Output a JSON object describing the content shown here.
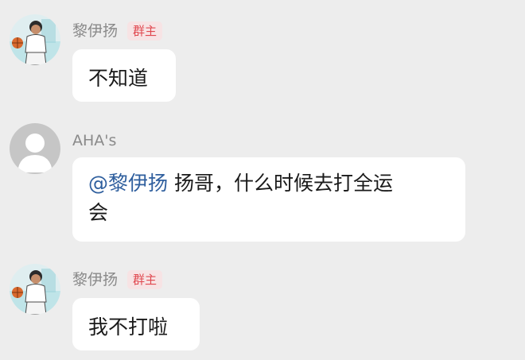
{
  "messages": [
    {
      "sender": "黎伊扬",
      "badge": "群主",
      "avatar_icon": "basketball-player-avatar-icon",
      "text": "不知道"
    },
    {
      "sender": "AHA's",
      "avatar_icon": "default-user-avatar-icon",
      "mention": "@黎伊扬",
      "text_line1": " 扬哥，什么时候去打全运",
      "text_line2": "会"
    },
    {
      "sender": "黎伊扬",
      "badge": "群主",
      "avatar_icon": "basketball-player-avatar-icon",
      "text": "我不打啦"
    }
  ],
  "colors": {
    "background": "#ededed",
    "bubble": "#ffffff",
    "mention": "#2f5f9e",
    "badge_text": "#e0484f",
    "badge_bg": "#f7e3e4",
    "name": "#8a8a8a"
  }
}
